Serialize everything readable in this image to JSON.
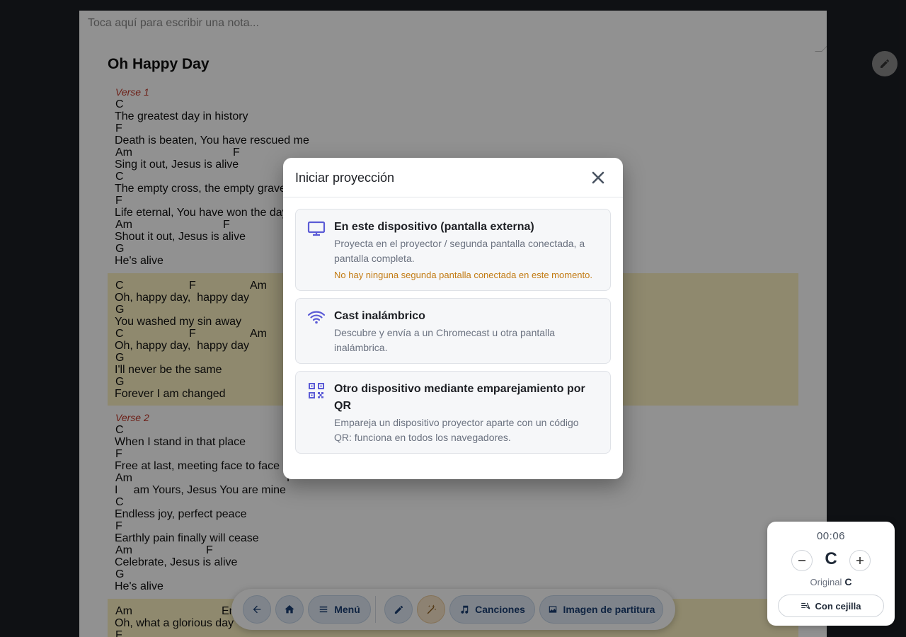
{
  "note": {
    "placeholder": "Toca aquí para escribir una nota..."
  },
  "song": {
    "title": "Oh Happy Day",
    "sections": [
      {
        "label": "Verse 1",
        "type": "verse",
        "lines": [
          {
            "chords": [
              {
                "c": "C",
                "pos": 0
              }
            ],
            "lyric": "The greatest day in history"
          },
          {
            "chords": [
              {
                "c": "F",
                "pos": 0
              }
            ],
            "lyric": "Death is beaten, You have rescued me"
          },
          {
            "chords": [
              {
                "c": "Am",
                "pos": 0
              },
              {
                "c": "F",
                "pos": 166
              }
            ],
            "lyric": "Sing it out, Jesus is alive"
          },
          {
            "chords": [
              {
                "c": "C",
                "pos": 0
              }
            ],
            "lyric": "The empty cross, the empty grave"
          },
          {
            "chords": [
              {
                "c": "F",
                "pos": 0
              }
            ],
            "lyric": "Life eternal, You have won the day"
          },
          {
            "chords": [
              {
                "c": "Am",
                "pos": 0
              },
              {
                "c": "F",
                "pos": 152
              }
            ],
            "lyric": "Shout it out, Jesus is alive"
          },
          {
            "chords": [
              {
                "c": "G",
                "pos": 0
              }
            ],
            "lyric": "He's alive"
          }
        ]
      },
      {
        "label": "",
        "type": "chorus",
        "lines": [
          {
            "chords": [
              {
                "c": "C",
                "pos": 0
              },
              {
                "c": "F",
                "pos": 104
              },
              {
                "c": "Am",
                "pos": 190
              }
            ],
            "lyric": "Oh, happy day,  happy day"
          },
          {
            "chords": [
              {
                "c": "G",
                "pos": 0
              }
            ],
            "lyric": "You washed my sin away"
          },
          {
            "chords": [
              {
                "c": "C",
                "pos": 0
              },
              {
                "c": "F",
                "pos": 104
              },
              {
                "c": "Am",
                "pos": 190
              }
            ],
            "lyric": "Oh, happy day,  happy day"
          },
          {
            "chords": [
              {
                "c": "G",
                "pos": 0
              }
            ],
            "lyric": "I'll never be the same"
          },
          {
            "chords": [
              {
                "c": "G",
                "pos": 0
              }
            ],
            "lyric": "Forever I am changed"
          }
        ]
      },
      {
        "label": "Verse 2",
        "type": "verse",
        "lines": [
          {
            "chords": [
              {
                "c": "C",
                "pos": 0
              }
            ],
            "lyric": "When I stand in that place"
          },
          {
            "chords": [
              {
                "c": "F",
                "pos": 0
              }
            ],
            "lyric": "Free at last, meeting face to face"
          },
          {
            "chords": [
              {
                "c": "Am",
                "pos": 0
              },
              {
                "c": "F",
                "pos": 242
              }
            ],
            "lyric": "I     am Yours, Jesus You are mine"
          },
          {
            "chords": [
              {
                "c": "C",
                "pos": 0
              }
            ],
            "lyric": "Endless joy, perfect peace"
          },
          {
            "chords": [
              {
                "c": "F",
                "pos": 0
              }
            ],
            "lyric": "Earthly pain finally will cease"
          },
          {
            "chords": [
              {
                "c": "Am",
                "pos": 0
              },
              {
                "c": "F",
                "pos": 128
              }
            ],
            "lyric": "Celebrate, Jesus is alive"
          },
          {
            "chords": [
              {
                "c": "G",
                "pos": 0
              }
            ],
            "lyric": "He's alive"
          }
        ]
      },
      {
        "label": "",
        "type": "chorus",
        "lines": [
          {
            "chords": [
              {
                "c": "Am",
                "pos": 0
              },
              {
                "c": "Em",
                "pos": 150
              }
            ],
            "lyric": "Oh, what a glorious day"
          },
          {
            "chords": [
              {
                "c": "F",
                "pos": 0
              }
            ],
            "lyric": ""
          }
        ]
      }
    ]
  },
  "modal": {
    "title": "Iniciar proyección",
    "options": [
      {
        "icon": "monitor-icon",
        "title": "En este dispositivo (pantalla externa)",
        "desc": "Proyecta en el proyector / segunda pantalla conectada, a pantalla completa.",
        "warning": "No hay ninguna segunda pantalla conectada en este momento."
      },
      {
        "icon": "wifi-icon",
        "title": "Cast inalámbrico",
        "desc": "Descubre y envía a un Chromecast u otra pantalla inalámbrica."
      },
      {
        "icon": "qr-code-icon",
        "title": "Otro dispositivo mediante emparejamiento por QR",
        "desc": "Empareja un dispositivo proyector aparte con un código QR: funciona en todos los navegadores."
      }
    ]
  },
  "toolbar": {
    "menu_label": "Menú",
    "songs_label": "Canciones",
    "sheet_image_label": "Imagen de partitura"
  },
  "key_widget": {
    "timer": "00:06",
    "key": "C",
    "original_label": "Original",
    "original_key": "C",
    "capo_label": "Con cejilla"
  },
  "colors": {
    "accent": "#1b3f73",
    "icon_purple": "#5b5bd6",
    "warning": "#c27a12",
    "section_label": "#c0392b",
    "chorus_bg": "#fbf1c1"
  }
}
